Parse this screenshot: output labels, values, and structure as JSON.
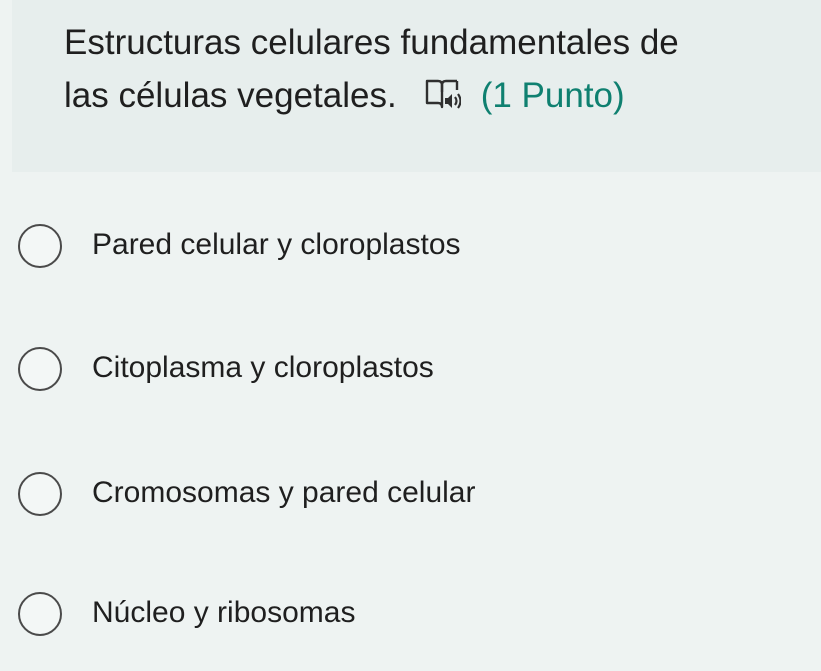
{
  "question": {
    "title_line1": "Estructuras celulares fundamentales de",
    "title_line2": "las células vegetales.",
    "points": "(1 Punto)",
    "icon": "immersive-reader-icon",
    "points_color": "#0f8070"
  },
  "options": [
    {
      "label": "Pared celular y cloroplastos",
      "selected": false
    },
    {
      "label": "Citoplasma y cloroplastos",
      "selected": false
    },
    {
      "label": "Cromosomas y pared celular",
      "selected": false
    },
    {
      "label": "Núcleo y ribosomas",
      "selected": false
    }
  ]
}
